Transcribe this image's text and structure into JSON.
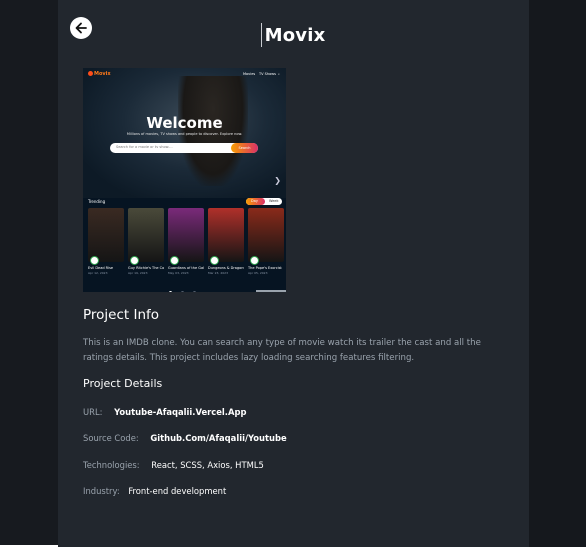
{
  "header": {
    "title": "Movix",
    "back_icon": "arrow-left-icon"
  },
  "thumbnail": {
    "logo": "Movix",
    "nav": [
      "Movies",
      "TV Shows"
    ],
    "hero_title": "Welcome",
    "hero_subtitle": "Millions of movies, TV shows and people to discover. Explore now.",
    "search_placeholder": "Search for a movie or tv show....",
    "search_button": "Search",
    "trending_label": "Trending",
    "toggle": [
      "Day",
      "Week"
    ],
    "posters": [
      {
        "name": "Evil Dead Rise",
        "date": "Apr 12, 2023",
        "color": "#3a2a22"
      },
      {
        "name": "Guy Ritchie's The Covenant",
        "date": "Apr 19, 2023",
        "color": "#4a4a3a"
      },
      {
        "name": "Guardians of the Galaxy",
        "date": "May 03, 2023",
        "color": "#7a2a7a"
      },
      {
        "name": "Dungeons & Dragons",
        "date": "Mar 23, 2023",
        "color": "#b0302a"
      },
      {
        "name": "The Pope's Exorcist",
        "date": "Apr 05, 2023",
        "color": "#8a2a1a"
      }
    ]
  },
  "project_info": {
    "heading": "Project Info",
    "description": "This is an IMDB clone. You can search any type of movie watch its trailer the cast and all the ratings details. This project includes lazy loading searching features filtering."
  },
  "project_details": {
    "heading": "Project Details",
    "url_label": "URL:",
    "url_value": "Youtube-Afaqalii.Vercel.App",
    "source_label": "Source Code:",
    "source_value": "Github.Com/Afaqalii/Youtube",
    "tech_label": "Technologies:",
    "tech_value": "React, SCSS, Axios, HTML5",
    "industry_label": "Industry:",
    "industry_value": "Front-end development"
  }
}
